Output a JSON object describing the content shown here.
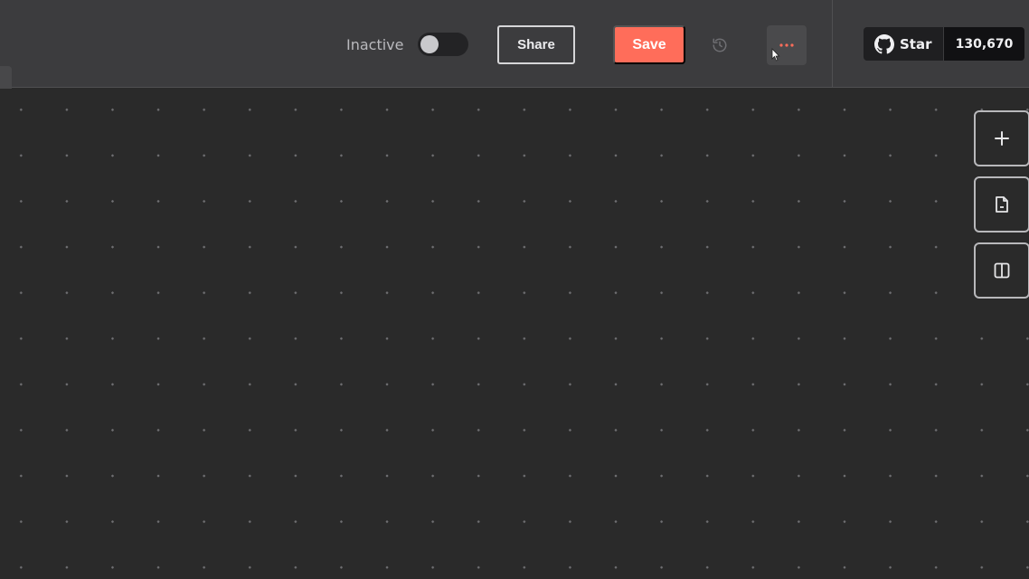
{
  "header": {
    "active_label": "Inactive",
    "active_state": false,
    "share_label": "Share",
    "save_label": "Save",
    "history_icon": "history-icon",
    "more_icon": "ellipsis-icon"
  },
  "github": {
    "star_label": "Star",
    "star_count": "130,670",
    "icon": "github-icon"
  },
  "toolbar": {
    "add_icon": "plus-icon",
    "sticky_icon": "sticky-note-icon",
    "panel_icon": "panel-icon"
  },
  "colors": {
    "accent": "#ff6d5a",
    "header_bg": "#3c3c3e",
    "canvas_bg": "#2a2a2a"
  }
}
